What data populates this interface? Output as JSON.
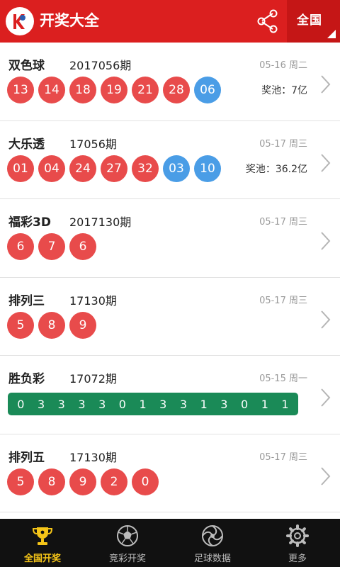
{
  "header": {
    "title": "开奖大全",
    "region": "全国",
    "logo_icon": "lottery-logo-icon",
    "share_icon": "share-icon"
  },
  "colors": {
    "header_bg": "#db1f1f",
    "red_ball": "#e84b4b",
    "blue_ball": "#4a9de6",
    "green_bar": "#1a8a57",
    "tab_active": "#f5c518"
  },
  "lotteries": [
    {
      "name": "双色球",
      "issue": "2017056期",
      "date": "05-16 周二",
      "pool": "奖池：7亿",
      "red": [
        "13",
        "14",
        "18",
        "19",
        "21",
        "28"
      ],
      "blue": [
        "06"
      ]
    },
    {
      "name": "大乐透",
      "issue": "17056期",
      "date": "05-17 周三",
      "pool": "奖池：36.2亿",
      "red": [
        "01",
        "04",
        "24",
        "27",
        "32"
      ],
      "blue": [
        "03",
        "10"
      ]
    },
    {
      "name": "福彩3D",
      "issue": "2017130期",
      "date": "05-17 周三",
      "red": [
        "6",
        "7",
        "6"
      ]
    },
    {
      "name": "排列三",
      "issue": "17130期",
      "date": "05-17 周三",
      "red": [
        "5",
        "8",
        "9"
      ]
    },
    {
      "name": "胜负彩",
      "issue": "17072期",
      "date": "05-15 周一",
      "digits": [
        "0",
        "3",
        "3",
        "3",
        "3",
        "0",
        "1",
        "3",
        "3",
        "1",
        "3",
        "0",
        "1",
        "1"
      ]
    },
    {
      "name": "排列五",
      "issue": "17130期",
      "date": "05-17 周三",
      "red": [
        "5",
        "8",
        "9",
        "2",
        "0"
      ]
    }
  ],
  "tabs": [
    {
      "label": "全国开奖",
      "icon": "trophy-icon",
      "active": true
    },
    {
      "label": "竞彩开奖",
      "icon": "soccer-ball-icon",
      "active": false
    },
    {
      "label": "足球数据",
      "icon": "swirl-icon",
      "active": false
    },
    {
      "label": "更多",
      "icon": "gear-icon",
      "active": false
    }
  ]
}
